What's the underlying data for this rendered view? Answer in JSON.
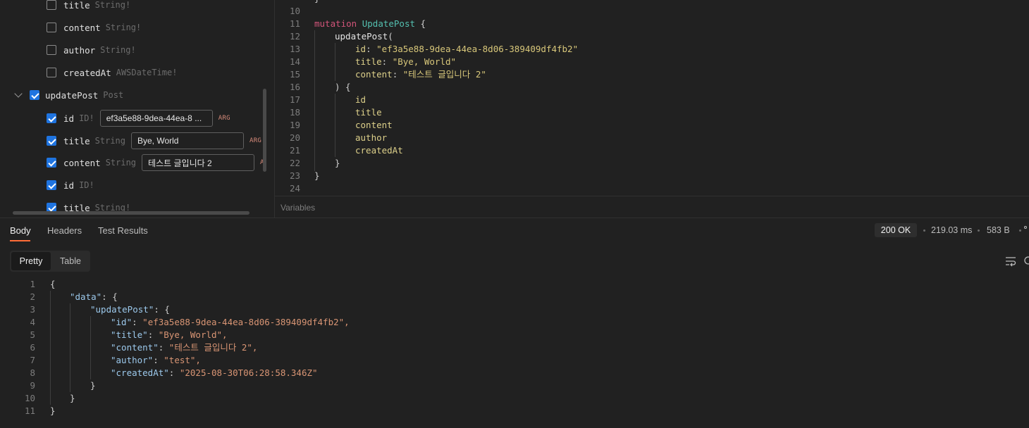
{
  "explorer": {
    "rows": [
      {
        "name": "title",
        "type": "String!",
        "checked": false
      },
      {
        "name": "content",
        "type": "String!",
        "checked": false
      },
      {
        "name": "author",
        "type": "String!",
        "checked": false
      },
      {
        "name": "createdAt",
        "type": "AWSDateTime!",
        "checked": false
      },
      {
        "name": "updatePost",
        "type": "Post",
        "checked": true
      },
      {
        "name": "id",
        "type": "ID!",
        "checked": true,
        "value": "ef3a5e88-9dea-44ea-8 ...",
        "tag": "ARG"
      },
      {
        "name": "title",
        "type": "String",
        "checked": true,
        "value": "Bye, World",
        "tag": "ARG"
      },
      {
        "name": "content",
        "type": "String",
        "checked": true,
        "value": "테스트 글입니다 2",
        "tag": "A"
      },
      {
        "name": "id",
        "type": "ID!",
        "checked": true
      },
      {
        "name": "title",
        "type": "String!",
        "checked": true
      }
    ]
  },
  "editor": {
    "line_numbers": [
      "10",
      "11",
      "12",
      "13",
      "14",
      "15",
      "16",
      "17",
      "18",
      "19",
      "20",
      "21",
      "22",
      "23",
      "24"
    ],
    "mutation_kw": "mutation",
    "op_name": "UpdatePost",
    "field": "updatePost",
    "args": [
      {
        "key": "id",
        "value": "\"ef3a5e88-9dea-44ea-8d06-389409df4fb2\""
      },
      {
        "key": "title",
        "value": "\"Bye, World\""
      },
      {
        "key": "content",
        "value": "\"테스트 글입니다 2\""
      }
    ],
    "selection": [
      "id",
      "title",
      "content",
      "author",
      "createdAt"
    ],
    "variables_label": "Variables"
  },
  "response": {
    "tabs": [
      "Body",
      "Headers",
      "Test Results"
    ],
    "status": "200 OK",
    "time": "219.03 ms",
    "size": "583 B",
    "view_modes": [
      "Pretty",
      "Table"
    ],
    "line_numbers": [
      "1",
      "2",
      "3",
      "4",
      "5",
      "6",
      "7",
      "8",
      "9",
      "10",
      "11"
    ],
    "json": {
      "data_key": "\"data\"",
      "update_key": "\"updatePost\"",
      "fields": [
        {
          "key": "\"id\"",
          "value": "\"ef3a5e88-9dea-44ea-8d06-389409df4fb2\","
        },
        {
          "key": "\"title\"",
          "value": "\"Bye, World\","
        },
        {
          "key": "\"content\"",
          "value": "\"테스트 글입니다 2\","
        },
        {
          "key": "\"author\"",
          "value": "\"test\","
        },
        {
          "key": "\"createdAt\"",
          "value": "\"2025-08-30T06:28:58.346Z\""
        }
      ]
    }
  },
  "colors": {
    "accent": "#ff6c37",
    "checkbox": "#1f74e0",
    "background": "#212121"
  }
}
